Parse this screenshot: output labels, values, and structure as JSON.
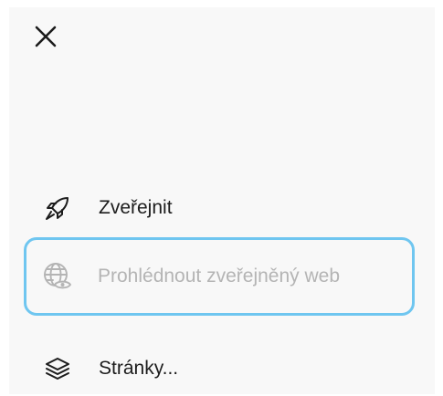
{
  "menu": {
    "close_icon": "close-icon",
    "items": [
      {
        "label": "Zveřejnit",
        "icon": "rocket-icon",
        "state": "enabled"
      },
      {
        "label": "Prohlédnout zveřejněný web",
        "icon": "globe-eye-icon",
        "state": "disabled"
      },
      {
        "label": "Stránky...",
        "icon": "layers-icon",
        "state": "enabled"
      }
    ]
  },
  "colors": {
    "panel_background": "#f8f8f8",
    "text": "#1c1c1c",
    "disabled_text": "#b4b4b4",
    "focus_outline": "#6fc6f0"
  }
}
